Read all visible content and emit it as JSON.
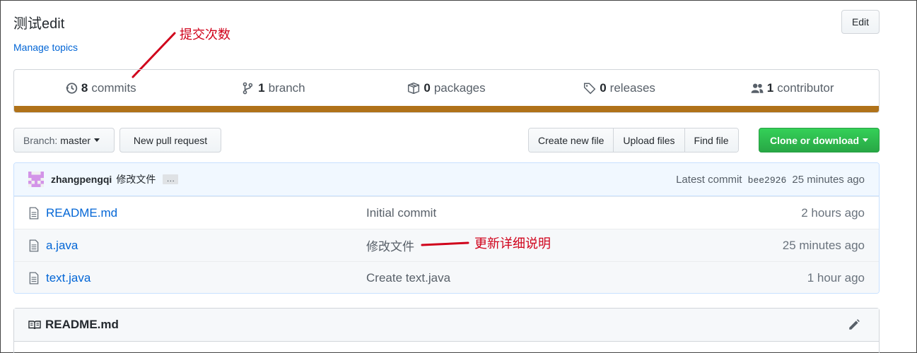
{
  "repo": {
    "title": "测试edit",
    "manage_topics": "Manage topics",
    "edit_label": "Edit"
  },
  "annotations": {
    "commits_note": "提交次数",
    "detail_note": "更新详细说明"
  },
  "summary": {
    "commits": {
      "count": "8",
      "label": "commits",
      "icon": "history-icon"
    },
    "branches": {
      "count": "1",
      "label": "branch",
      "icon": "branch-icon"
    },
    "packages": {
      "count": "0",
      "label": "packages",
      "icon": "package-icon"
    },
    "releases": {
      "count": "0",
      "label": "releases",
      "icon": "tag-icon"
    },
    "contributors": {
      "count": "1",
      "label": "contributor",
      "icon": "people-icon"
    },
    "language_bar_color": "#b07219"
  },
  "toolbar": {
    "branch_prefix": "Branch:",
    "branch_name": "master",
    "new_pr": "New pull request",
    "create_file": "Create new file",
    "upload_files": "Upload files",
    "find_file": "Find file",
    "clone": "Clone or download"
  },
  "latest_commit": {
    "author": "zhangpengqi",
    "message": "修改文件",
    "ellipsis": "…",
    "prefix": "Latest commit",
    "sha": "bee2926",
    "age": "25 minutes ago"
  },
  "files": [
    {
      "name": "README.md",
      "message": "Initial commit",
      "age": "2 hours ago"
    },
    {
      "name": "a.java",
      "message": "修改文件",
      "age": "25 minutes ago"
    },
    {
      "name": "text.java",
      "message": "Create text.java",
      "age": "1 hour ago"
    }
  ],
  "readme": {
    "title": "README.md"
  },
  "colors": {
    "link": "#0366d6",
    "annotation": "#d0021b",
    "clone_green": "#28a745"
  }
}
